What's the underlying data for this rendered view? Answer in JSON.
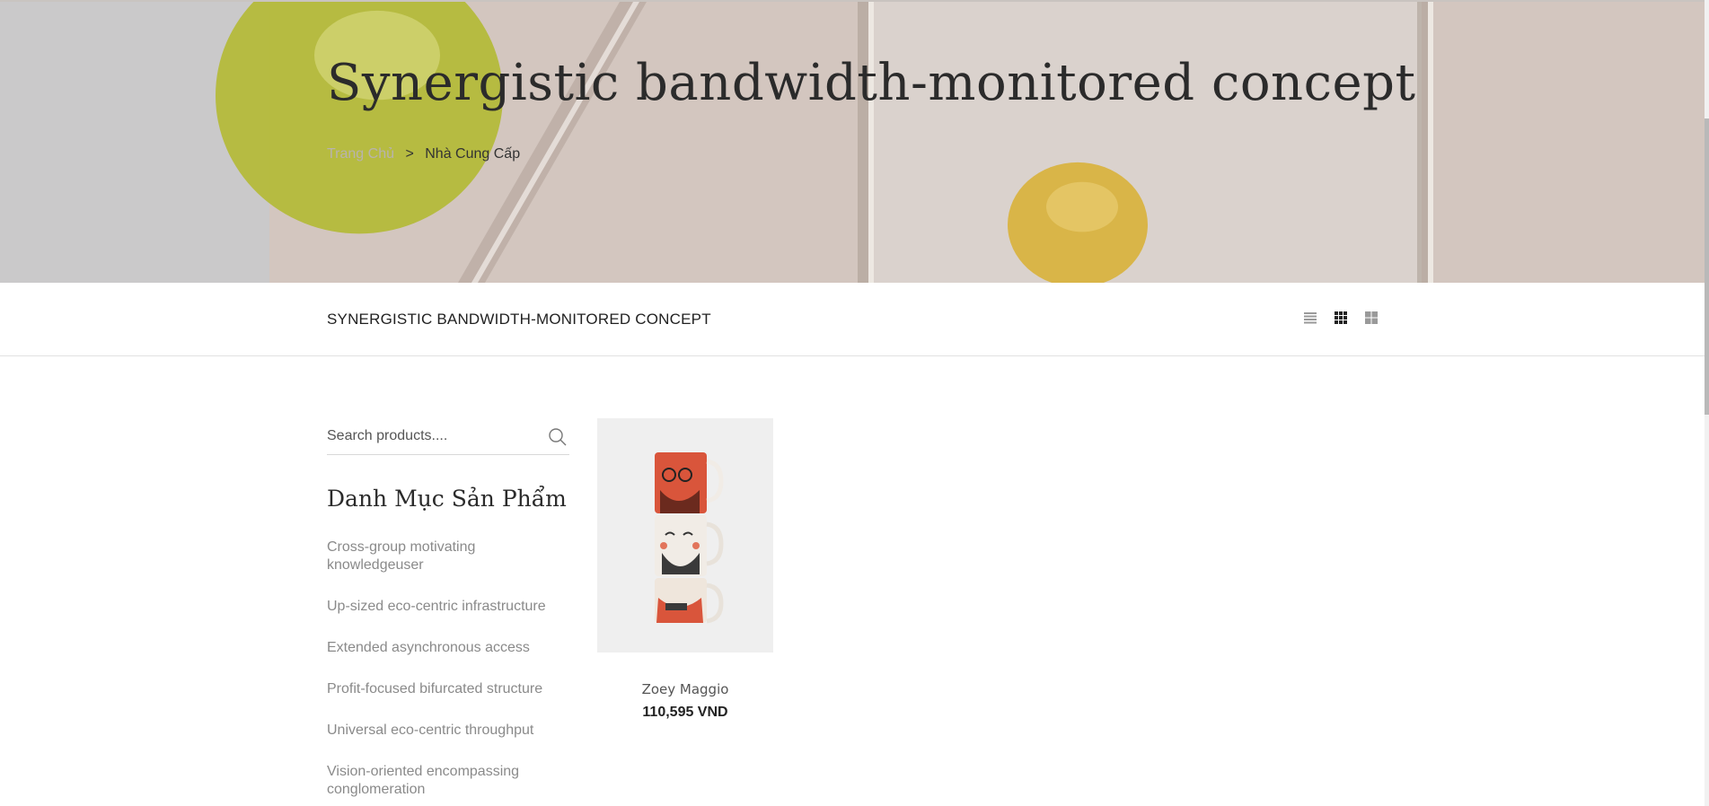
{
  "hero": {
    "title": "Synergistic bandwidth-monitored concept",
    "breadcrumb": {
      "home_label": "Trang Chủ",
      "separator": ">",
      "current_label": "Nhà Cung Cấp"
    }
  },
  "toolbar": {
    "title": "SYNERGISTIC BANDWIDTH-MONITORED CONCEPT",
    "view_modes": [
      "list-view-icon",
      "grid-3-view-icon",
      "grid-2-view-icon"
    ],
    "active_view": "grid-3-view-icon"
  },
  "sidebar": {
    "search": {
      "placeholder": "Search products....",
      "value": ""
    },
    "categories_heading": "Danh Mục Sản Phẩm",
    "categories": [
      "Cross-group motivating knowledgeuser",
      "Up-sized eco-centric infrastructure",
      "Extended asynchronous access",
      "Profit-focused bifurcated structure",
      "Universal eco-centric throughput",
      "Vision-oriented encompassing conglomeration"
    ]
  },
  "products": [
    {
      "name": "Zoey Maggio",
      "price": "110,595 VND",
      "image_icon": "stacked-mugs-image"
    }
  ],
  "colors": {
    "text_dark": "#2b2b2b",
    "text_muted": "#8a8a8a",
    "breadcrumb_link": "#b8b3ae",
    "card_bg": "#efefef",
    "mug_red": "#d9553b"
  }
}
